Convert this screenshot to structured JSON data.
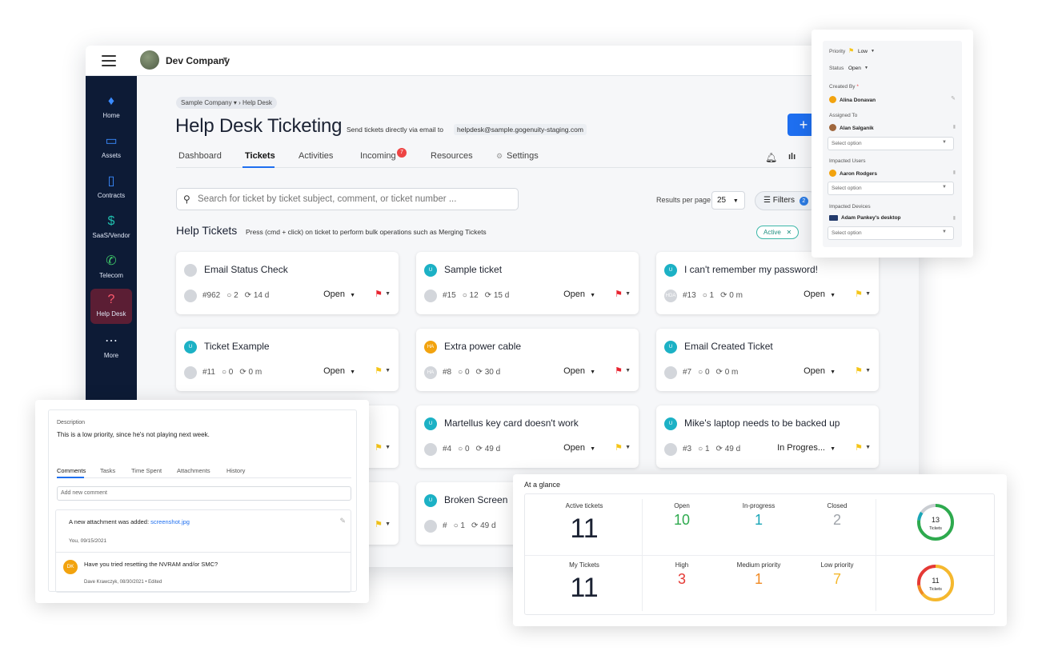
{
  "topbar": {
    "company": "Dev Company"
  },
  "sidebar": {
    "items": [
      {
        "label": "Home"
      },
      {
        "label": "Assets"
      },
      {
        "label": "Contracts"
      },
      {
        "label": "SaaS/Vendor"
      },
      {
        "label": "Telecom"
      },
      {
        "label": "Help Desk"
      },
      {
        "label": "More"
      }
    ]
  },
  "breadcrumb": {
    "parent": "Sample Company",
    "current": "Help Desk"
  },
  "header": {
    "title": "Help Desk Ticketing",
    "subtitle": "Send tickets directly via email to",
    "email": "helpdesk@sample.gogenuity-staging.com",
    "add_label": "+"
  },
  "tabs": [
    {
      "label": "Dashboard"
    },
    {
      "label": "Tickets"
    },
    {
      "label": "Activities"
    },
    {
      "label": "Incoming",
      "badge": "7"
    },
    {
      "label": "Resources"
    },
    {
      "label": "Settings"
    }
  ],
  "search": {
    "placeholder": "Search for ticket by ticket subject, comment, or ticket number ..."
  },
  "results_per_page": {
    "label": "Results per page",
    "value": "25"
  },
  "filters": {
    "label": "Filters",
    "count": "2"
  },
  "tickets_section": {
    "title": "Help Tickets",
    "hint": "Press (cmd + click) on ticket to perform bulk operations such as Merging Tickets",
    "chip": "Active"
  },
  "tickets": [
    {
      "title": "Email Status Check",
      "avatar": "",
      "assignee": "",
      "number": "#962",
      "comments": "2",
      "age": "14 d",
      "status": "Open",
      "flag": "red"
    },
    {
      "title": "Sample ticket",
      "avatar": "U",
      "assignee": "",
      "number": "#15",
      "comments": "12",
      "age": "15 d",
      "status": "Open",
      "flag": "red"
    },
    {
      "title": "I can't remember my password!",
      "avatar": "U",
      "assignee": "HDA",
      "number": "#13",
      "comments": "1",
      "age": "0 m",
      "status": "Open",
      "flag": "yellow"
    },
    {
      "title": "Ticket Example",
      "avatar": "U",
      "assignee": "",
      "number": "#11",
      "comments": "0",
      "age": "0 m",
      "status": "Open",
      "flag": "yellow"
    },
    {
      "title": "Extra power cable",
      "avatar": "HA",
      "assignee": "HA",
      "number": "#8",
      "comments": "0",
      "age": "30 d",
      "status": "Open",
      "flag": "red"
    },
    {
      "title": "Email Created Ticket",
      "avatar": "U",
      "assignee": "",
      "number": "#7",
      "comments": "0",
      "age": "0 m",
      "status": "Open",
      "flag": "yellow"
    },
    {
      "title": "Martellus key card doesn't work",
      "avatar": "U",
      "assignee": "",
      "number": "#4",
      "comments": "0",
      "age": "49 d",
      "status": "Open",
      "flag": "yellow"
    },
    {
      "title": "Mike's laptop needs to be backed up",
      "avatar": "U",
      "assignee": "",
      "number": "#3",
      "comments": "1",
      "age": "49 d",
      "status": "In Progres...",
      "flag": "yellow"
    },
    {
      "title": "Broken Screen",
      "avatar": "U",
      "assignee": "",
      "number": "#",
      "comments": "1",
      "age": "49 d",
      "status": "",
      "flag": ""
    }
  ],
  "description_panel": {
    "label": "Description",
    "text": "This is a low priority, since he's not playing next week.",
    "tabs": [
      "Comments",
      "Tasks",
      "Time Spent",
      "Attachments",
      "History"
    ],
    "comment_placeholder": "Add new comment",
    "comments": [
      {
        "text": "A new attachment was added:",
        "link": "screenshot.jpg",
        "meta": "You, 09/15/2021"
      },
      {
        "avatar": "DK",
        "text": "Have you tried resetting the NVRAM and/or SMC?",
        "meta": "Dave Krawczyk, 08/30/2021 • Edited"
      }
    ]
  },
  "glance": {
    "title": "At a glance",
    "active": {
      "label": "Active tickets",
      "value": "11"
    },
    "open": {
      "label": "Open",
      "value": "10"
    },
    "inprogress": {
      "label": "In-progress",
      "value": "1"
    },
    "closed": {
      "label": "Closed",
      "value": "2"
    },
    "ring1": {
      "value": "13",
      "label": "Tickets"
    },
    "mine": {
      "label": "My Tickets",
      "value": "11"
    },
    "high": {
      "label": "High",
      "value": "3"
    },
    "medium": {
      "label": "Medium priority",
      "value": "1"
    },
    "low": {
      "label": "Low priority",
      "value": "7"
    },
    "ring2": {
      "value": "11",
      "label": "Tickets"
    },
    "colors": {
      "open": "#2eaa4e",
      "inprogress": "#1aa6b7",
      "closed": "#9ea3a9",
      "high": "#e53935",
      "medium": "#f08a24",
      "low": "#f5b82e"
    }
  },
  "priority_panel": {
    "priority_label": "Priority",
    "priority_value": "Low",
    "status_label": "Status",
    "status_value": "Open",
    "created_label": "Created By",
    "created_value": "Alina Donavan",
    "assigned_label": "Assigned To",
    "assigned_value": "Alan Salganik",
    "select_placeholder": "Select option",
    "users_label": "Impacted Users",
    "users_value": "Aaron Rodgers",
    "devices_label": "Impacted Devices",
    "devices_value": "Adam Pankey's desktop"
  }
}
